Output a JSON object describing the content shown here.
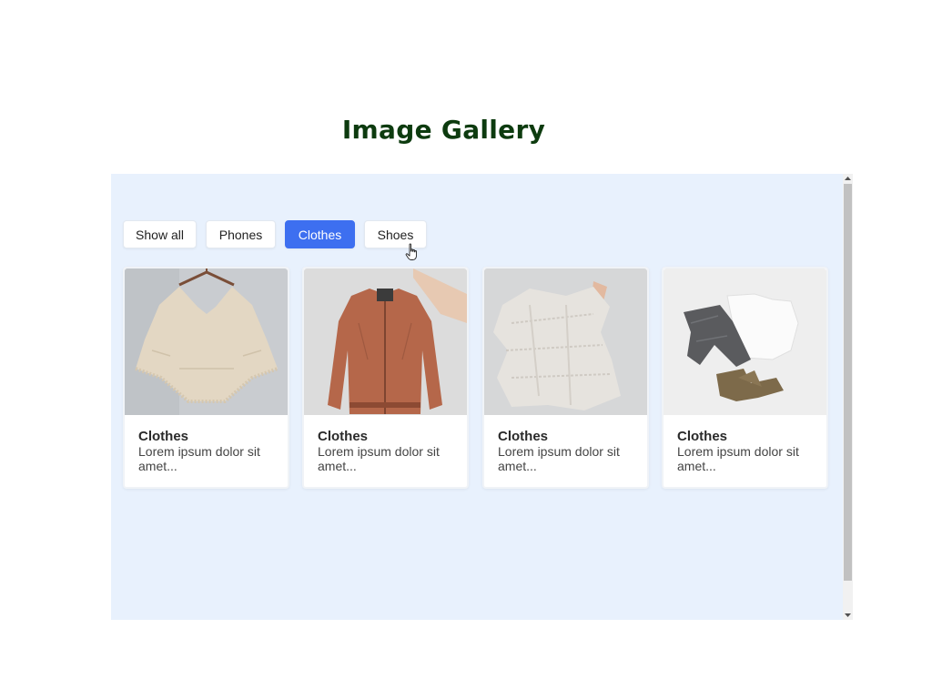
{
  "page": {
    "title": "Image Gallery"
  },
  "filters": [
    {
      "label": "Show all",
      "active": false
    },
    {
      "label": "Phones",
      "active": false
    },
    {
      "label": "Clothes",
      "active": true
    },
    {
      "label": "Shoes",
      "active": false
    }
  ],
  "cards": [
    {
      "title": "Clothes",
      "description": "Lorem ipsum dolor sit amet...",
      "image": "knit-poncho-on-hanger"
    },
    {
      "title": "Clothes",
      "description": "Lorem ipsum dolor sit amet...",
      "image": "rust-bomber-jacket"
    },
    {
      "title": "Clothes",
      "description": "Lorem ipsum dolor sit amet...",
      "image": "white-knit-sweater"
    },
    {
      "title": "Clothes",
      "description": "Lorem ipsum dolor sit amet...",
      "image": "jeans-tee-boots-flatlay"
    }
  ],
  "colors": {
    "title": "#0d3b0f",
    "frame_bg": "#e8f1fd",
    "accent": "#3d6ff0"
  },
  "icons": [
    "pointer-cursor-icon",
    "scroll-up-arrow-icon",
    "scroll-down-arrow-icon"
  ]
}
